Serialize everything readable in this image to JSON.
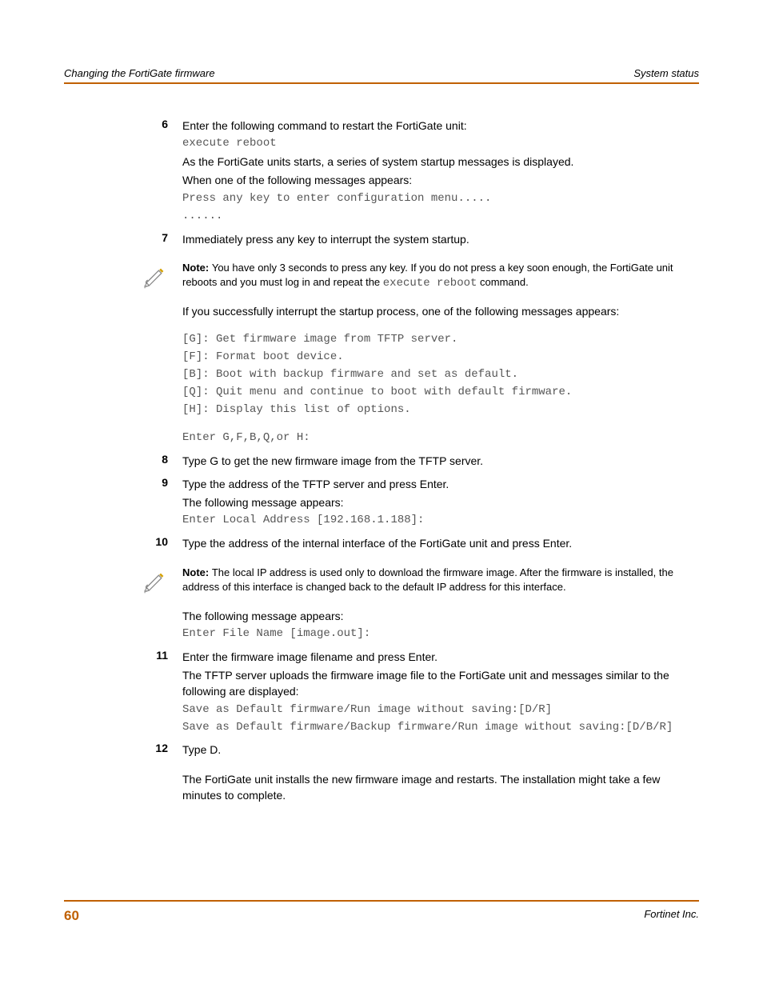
{
  "header": {
    "left": "Changing the FortiGate firmware",
    "right": "System status"
  },
  "steps": {
    "s6": {
      "num": "6",
      "l1": "Enter the following command to restart the FortiGate unit:",
      "code1": "execute reboot",
      "l2": "As the FortiGate units starts, a series of system startup messages is displayed.",
      "l3": "When one of the following messages appears:",
      "code2": "Press any key to enter configuration menu.....",
      "code3": "......"
    },
    "s7": {
      "num": "7",
      "l1": "Immediately press any key to interrupt the system startup."
    },
    "note1": {
      "bold": "Note: ",
      "t1": "You have only 3 seconds to press any key. If you do not press a key soon enough, the FortiGate unit reboots and you must log in and repeat the ",
      "code": "execute reboot",
      "t2": " command."
    },
    "after_note1": {
      "l1": "If you successfully interrupt the startup process, one of the following messages appears:",
      "codeA": "[G]:  Get firmware image from TFTP server.",
      "codeB": "[F]:  Format boot device.",
      "codeC": "[B]:  Boot with backup firmware and set as default.",
      "codeD": "[Q]:  Quit menu and continue to boot with default firmware.",
      "codeE": "[H]:  Display this list of options.",
      "codeF": "Enter G,F,B,Q,or H:"
    },
    "s8": {
      "num": "8",
      "l1": "Type G to get the new firmware image from the TFTP server."
    },
    "s9": {
      "num": "9",
      "l1": "Type the address of the TFTP server and press Enter.",
      "l2": "The following message appears:",
      "code1": "Enter Local Address [192.168.1.188]:"
    },
    "s10": {
      "num": "10",
      "l1": "Type the address of the internal interface of the FortiGate unit and press Enter."
    },
    "note2": {
      "bold": "Note: ",
      "t1": "The local IP address is used only to download the firmware image. After the firmware is installed, the address of this interface is changed back to the default IP address for this interface."
    },
    "after_note2": {
      "l1": "The following message appears:",
      "code1": "Enter File Name [image.out]:"
    },
    "s11": {
      "num": "11",
      "l1": "Enter the firmware image filename and press Enter.",
      "l2": "The TFTP server uploads the firmware image file to the FortiGate unit and messages similar to the following are displayed:",
      "code1": "Save as Default firmware/Run image without saving:[D/R]",
      "code2": "Save as Default firmware/Backup firmware/Run image without saving:[D/B/R]"
    },
    "s12": {
      "num": "12",
      "l1": "Type D.",
      "l2": "The FortiGate unit installs the new firmware image and restarts. The installation might take a few minutes to complete."
    }
  },
  "footer": {
    "page": "60",
    "company": "Fortinet Inc."
  }
}
